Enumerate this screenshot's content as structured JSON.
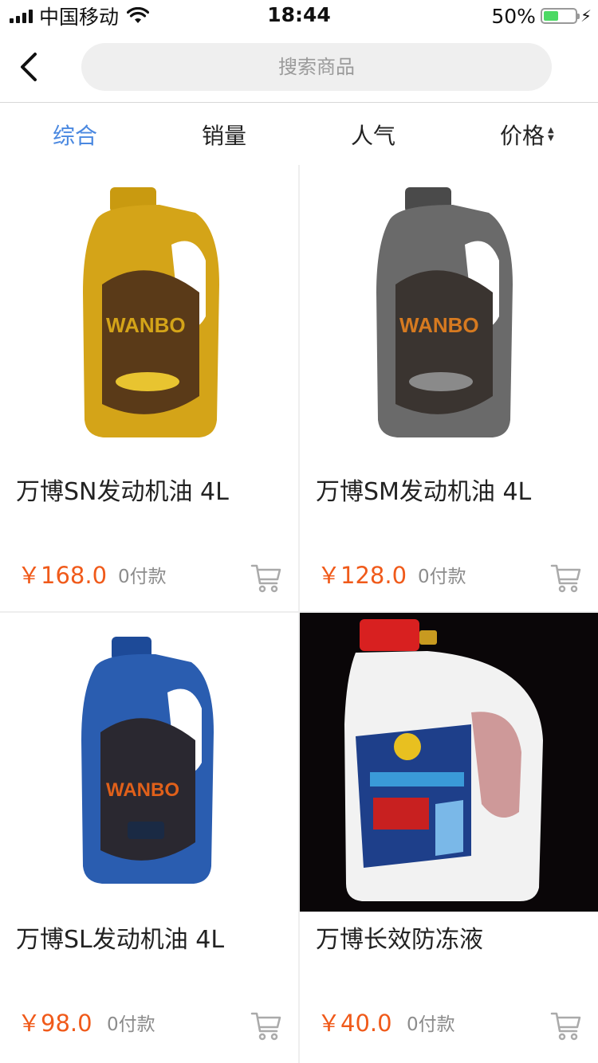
{
  "status_bar": {
    "carrier": "中国移动",
    "time": "18:44",
    "battery": "50%"
  },
  "nav": {
    "back_icon": "chevron-left-icon",
    "search_placeholder": "搜索商品"
  },
  "sort_tabs": [
    {
      "label": "综合",
      "active": true
    },
    {
      "label": "销量",
      "active": false
    },
    {
      "label": "人气",
      "active": false
    },
    {
      "label": "价格",
      "active": false
    }
  ],
  "colors": {
    "accent": "#4a88e0",
    "price": "#f05a1a",
    "muted": "#8c8c8c"
  },
  "products": [
    {
      "name": "万博SN发动机油 4L",
      "price": "￥168.0",
      "paid": "0付款",
      "image": "gold-oil-bottle",
      "bottle_color": "#d4a418"
    },
    {
      "name": "万博SM发动机油 4L",
      "price": "￥128.0",
      "paid": "0付款",
      "image": "gray-oil-bottle",
      "bottle_color": "#6a6a6a"
    },
    {
      "name": "万博SL发动机油 4L",
      "price": "￥98.0",
      "paid": "0付款",
      "image": "blue-oil-bottle",
      "bottle_color": "#2a5db0"
    },
    {
      "name": "万博长效防冻液",
      "price": "￥40.0",
      "paid": "0付款",
      "image": "white-antifreeze-bottle",
      "bottle_color": "#f2f2f2"
    }
  ]
}
